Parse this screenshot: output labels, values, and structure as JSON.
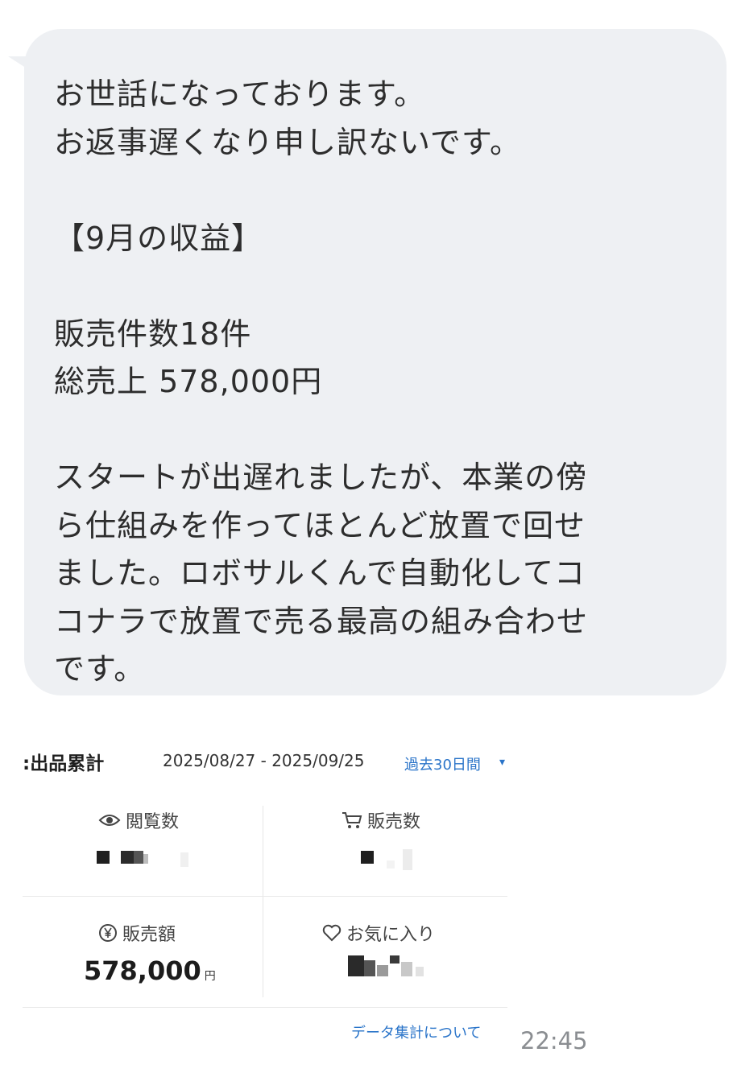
{
  "message": {
    "lines": [
      "お世話になっております。",
      "お返事遅くなり申し訳ないです。",
      "",
      "【9月の収益】",
      "",
      "販売件数18件",
      "総売上 578,000円",
      "",
      "スタートが出遅れましたが、本業の傍",
      "ら仕組みを作ってほとんど放置で回せ",
      "ました。ロボサルくんで自動化してコ",
      "コナラで放置で売る最高の組み合わせ",
      "です。"
    ],
    "bubble_color": "#eef0f3"
  },
  "attachment": {
    "title": ":出品累計",
    "date_range": "2025/08/27 - 2025/09/25",
    "period_selector": "過去30日間",
    "stats": {
      "views": {
        "label": "閲覧数",
        "icon": "eye-icon"
      },
      "sales_count": {
        "label": "販売数",
        "icon": "cart-icon"
      },
      "sales_amount": {
        "label": "販売額",
        "icon": "yen-icon",
        "value": "578,000",
        "unit": "円"
      },
      "favorites": {
        "label": "お気に入り",
        "icon": "heart-icon"
      }
    },
    "footer_link": "データ集計について",
    "link_color": "#2a74c9"
  },
  "timestamp": "22:45"
}
